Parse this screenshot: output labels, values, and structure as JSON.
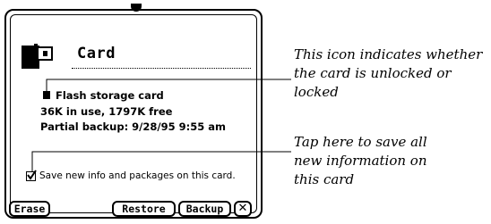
{
  "slip": {
    "title": "Card",
    "card_type": "Flash storage card",
    "usage": "36K in use, 1797K free",
    "backup": "Partial backup: 9/28/95 9:55 am",
    "save_checkbox": {
      "label": "Save new info and packages on this card.",
      "checked": true
    },
    "buttons": {
      "erase": "Erase",
      "restore": "Restore",
      "backup": "Backup",
      "close": "✕"
    },
    "icons": [
      "card-icon",
      "lock-status-icon",
      "close-icon"
    ]
  },
  "callouts": {
    "lock_callout": [
      "This icon indicates whether",
      "the card is unlocked or",
      "locked"
    ],
    "save_callout": [
      "Tap here to save all",
      "new information on",
      "this card"
    ]
  }
}
